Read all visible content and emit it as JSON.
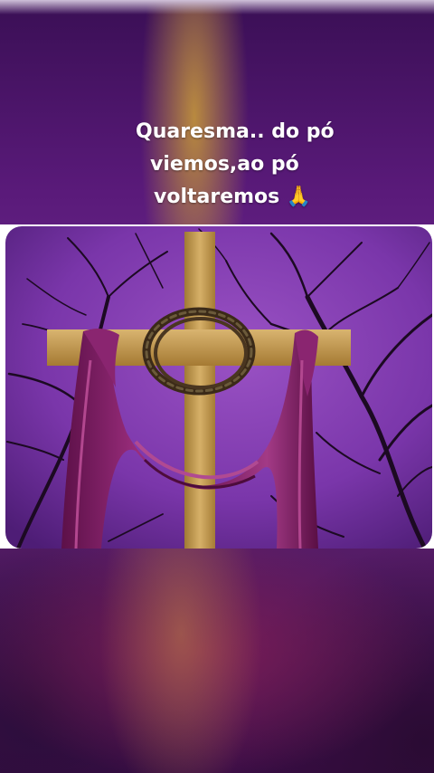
{
  "caption": {
    "line1": "Quaresma.. do pó",
    "line2": "viemos,ao pó",
    "line3": "voltaremos 🙏"
  },
  "image": {
    "subject": "wooden-cross-with-crown-of-thorns-and-purple-drape",
    "colors": {
      "background_purple": "#6b2a8c",
      "drape": "#7c1f63",
      "wood": "#c9a253"
    }
  }
}
